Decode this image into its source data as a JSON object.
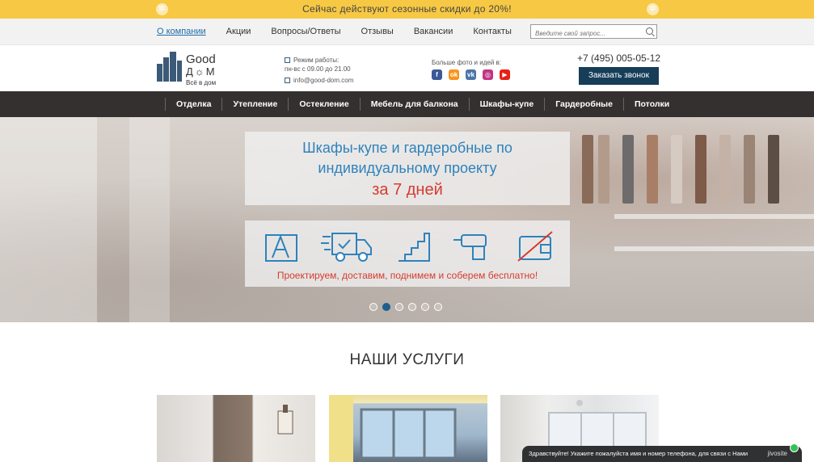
{
  "promo": {
    "text": "Сейчас действуют сезонные скидки до 20%!"
  },
  "topnav": {
    "links": [
      "О компании",
      "Акции",
      "Вопросы/Ответы",
      "Отзывы",
      "Вакансии",
      "Контакты"
    ],
    "search_placeholder": "Введите свой запрос..."
  },
  "header": {
    "logo": {
      "word1": "Good",
      "word2": "Д☼М",
      "tagline": "Всё в дом"
    },
    "schedule_title": "Режим работы:",
    "schedule_hours": "пн-вс с 09.00 до 21.00",
    "email": "info@good-dom.com",
    "social_title": "Больше фото и идей в:",
    "social": [
      "facebook-icon",
      "odnoklassniki-icon",
      "vk-icon",
      "instagram-icon",
      "youtube-icon"
    ],
    "phone": "+7 (495) 005-05-12",
    "call_button": "Заказать звонок"
  },
  "menu": [
    "Отделка",
    "Утепление",
    "Остекление",
    "Мебель для балкона",
    "Шкафы-купе",
    "Гардеробные",
    "Потолки"
  ],
  "hero": {
    "line1": "Шкафы-купе и гардеробные по",
    "line2": "индивидуальному проекту",
    "line3": "за 7 дней",
    "caption": "Проектируем, доставим, поднимем и соберем бесплатно!",
    "slides": 6,
    "active_slide": 2
  },
  "services": {
    "title": "НАШИ УСЛУГИ"
  },
  "chat": {
    "text": "Здравствуйте! Укажите пожалуйста имя и номер телефона, для связи с Нами",
    "brand": "jivosite"
  },
  "colors": {
    "promo": "#f7c843",
    "menu_bg": "#353030",
    "accent_blue": "#2e82bc",
    "accent_red": "#d63b2f",
    "button": "#173e59"
  }
}
